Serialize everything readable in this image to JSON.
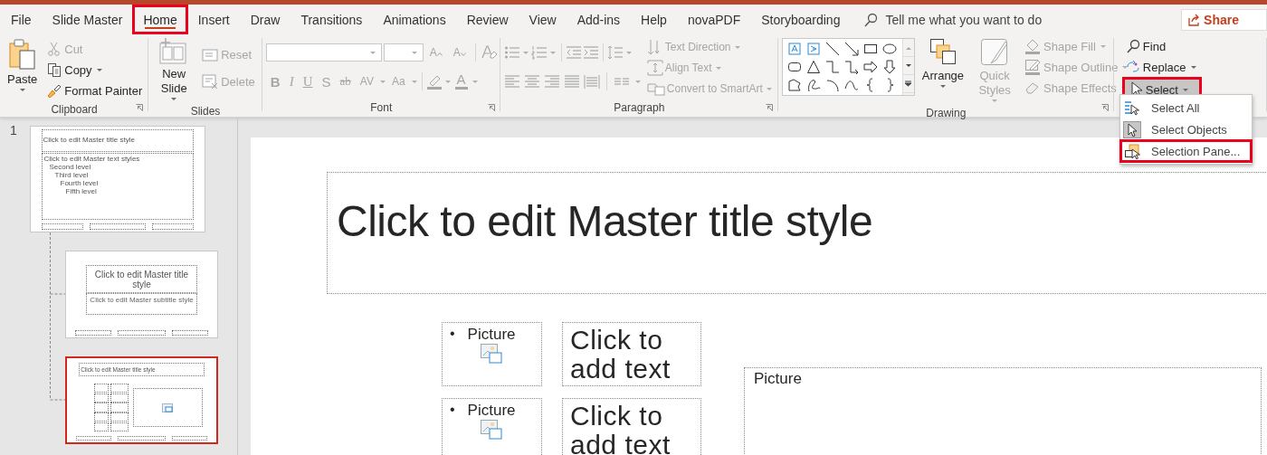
{
  "tabs": [
    {
      "label": "File",
      "selected": false,
      "highlighted": false
    },
    {
      "label": "Slide Master",
      "selected": false,
      "highlighted": false
    },
    {
      "label": "Home",
      "selected": true,
      "highlighted": true
    },
    {
      "label": "Insert",
      "selected": false,
      "highlighted": false
    },
    {
      "label": "Draw",
      "selected": false,
      "highlighted": false
    },
    {
      "label": "Transitions",
      "selected": false,
      "highlighted": false
    },
    {
      "label": "Animations",
      "selected": false,
      "highlighted": false
    },
    {
      "label": "Review",
      "selected": false,
      "highlighted": false
    },
    {
      "label": "View",
      "selected": false,
      "highlighted": false
    },
    {
      "label": "Add-ins",
      "selected": false,
      "highlighted": false
    },
    {
      "label": "Help",
      "selected": false,
      "highlighted": false
    },
    {
      "label": "novaPDF",
      "selected": false,
      "highlighted": false
    },
    {
      "label": "Storyboarding",
      "selected": false,
      "highlighted": false
    }
  ],
  "tell_me": {
    "placeholder": "Tell me what you want to do"
  },
  "share": {
    "label": "Share"
  },
  "ribbon": {
    "clipboard": {
      "label": "Clipboard",
      "paste": {
        "label": "Paste",
        "disabled": false
      },
      "cut": {
        "label": "Cut",
        "disabled": true
      },
      "copy": {
        "label": "Copy",
        "disabled": false
      },
      "format_painter": {
        "label": "Format Painter",
        "disabled": false
      }
    },
    "slides": {
      "label": "Slides",
      "new_slide": {
        "label": "New Slide",
        "disabled": false
      },
      "reset": {
        "label": "Reset",
        "disabled": true
      },
      "delete": {
        "label": "Delete",
        "disabled": true
      }
    },
    "font": {
      "label": "Font",
      "disabled": true,
      "grow": {
        "text": "A"
      },
      "shrink": {
        "text": "A"
      },
      "style_buttons": [
        {
          "text": "B"
        },
        {
          "text": "I"
        },
        {
          "text": "U"
        },
        {
          "text": "S"
        },
        {
          "text": "ab"
        },
        {
          "text": "AV"
        },
        {
          "text": "Aa"
        }
      ],
      "font_color": {
        "text": "A"
      }
    },
    "paragraph": {
      "label": "Paragraph",
      "text_direction": {
        "label": "Text Direction",
        "disabled": true
      },
      "align_text": {
        "label": "Align Text",
        "disabled": true
      },
      "smartart": {
        "label": "Convert to SmartArt",
        "disabled": true
      }
    },
    "drawing": {
      "label": "Drawing",
      "arrange": {
        "label": "Arrange",
        "disabled": false
      },
      "quick_styles": {
        "label": "Quick Styles",
        "disabled": true
      },
      "shape_fill": {
        "label": "Shape Fill",
        "disabled": true
      },
      "shape_outline": {
        "label": "Shape Outline",
        "disabled": true
      },
      "shape_effects": {
        "label": "Shape Effects",
        "disabled": true
      }
    },
    "editing": {
      "find": {
        "label": "Find"
      },
      "replace": {
        "label": "Replace"
      },
      "select": {
        "label": "Select",
        "pressed": true,
        "highlighted": true
      }
    }
  },
  "select_menu": {
    "items": [
      {
        "label": "Select All",
        "checked": false,
        "highlighted": false
      },
      {
        "label": "Select Objects",
        "checked": true,
        "highlighted": false
      },
      {
        "label": "Selection Pane...",
        "checked": false,
        "highlighted": true
      }
    ]
  },
  "slide_panel": {
    "number": "1",
    "thumbnails": [
      {
        "kind": "title_body",
        "selected": false,
        "title": "Click to edit Master title style",
        "body": [
          {
            "text": "Click to edit Master text styles",
            "children": [
              {
                "text": "Second level",
                "children": [
                  {
                    "text": "Third level",
                    "children": [
                      {
                        "text": "Fourth level",
                        "children": [
                          {
                            "text": "Fifth level"
                          }
                        ]
                      }
                    ]
                  }
                ]
              }
            ]
          }
        ]
      },
      {
        "kind": "title_slide",
        "selected": false,
        "title": "Click to edit Master title style",
        "subtitle": "Click to edit Master subtitle style"
      },
      {
        "kind": "picture_layout",
        "selected": true,
        "title": "Click to edit Master title style"
      }
    ]
  },
  "slide": {
    "title": "Click to edit Master title style",
    "rows": [
      {
        "bullet": "•",
        "picture_label": "Picture",
        "text": "Click to add text"
      },
      {
        "bullet": "•",
        "picture_label": "Picture",
        "text": "Click to add text"
      }
    ],
    "large_picture": {
      "label": "Picture"
    }
  }
}
